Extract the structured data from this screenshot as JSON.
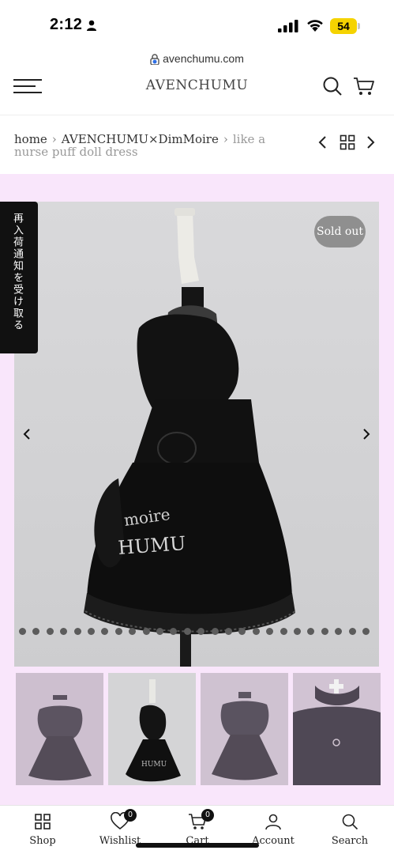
{
  "status_bar": {
    "time": "2:12",
    "battery": "54"
  },
  "browser": {
    "url": "avenchumu.com"
  },
  "header": {
    "logo": "AVENCHUMU",
    "menu_icon": "hamburger-icon",
    "search_icon": "search-icon",
    "cart_icon": "cart-icon"
  },
  "breadcrumb": {
    "items": [
      "home",
      "AVENCHUMU×DimMoire"
    ],
    "current": "like a nurse puff doll dress"
  },
  "product": {
    "sold_out_label": "Sold out",
    "side_tab_label": "再入荷通知を受け取る",
    "dot_count": 26
  },
  "thumbnails": [
    {
      "name": "front-view"
    },
    {
      "name": "side-view"
    },
    {
      "name": "back-view"
    },
    {
      "name": "collar-detail"
    }
  ],
  "tabbar": {
    "items": [
      {
        "label": "Shop",
        "icon": "grid-icon"
      },
      {
        "label": "Wishlist",
        "icon": "heart-icon",
        "badge": "0"
      },
      {
        "label": "Cart",
        "icon": "cart-icon",
        "badge": "0"
      },
      {
        "label": "Account",
        "icon": "user-icon"
      },
      {
        "label": "Search",
        "icon": "search-icon"
      }
    ]
  },
  "colors": {
    "accent_pink": "#f9e6fb",
    "sold_out_bg": "#8f8f8f",
    "battery": "#f5d300"
  }
}
